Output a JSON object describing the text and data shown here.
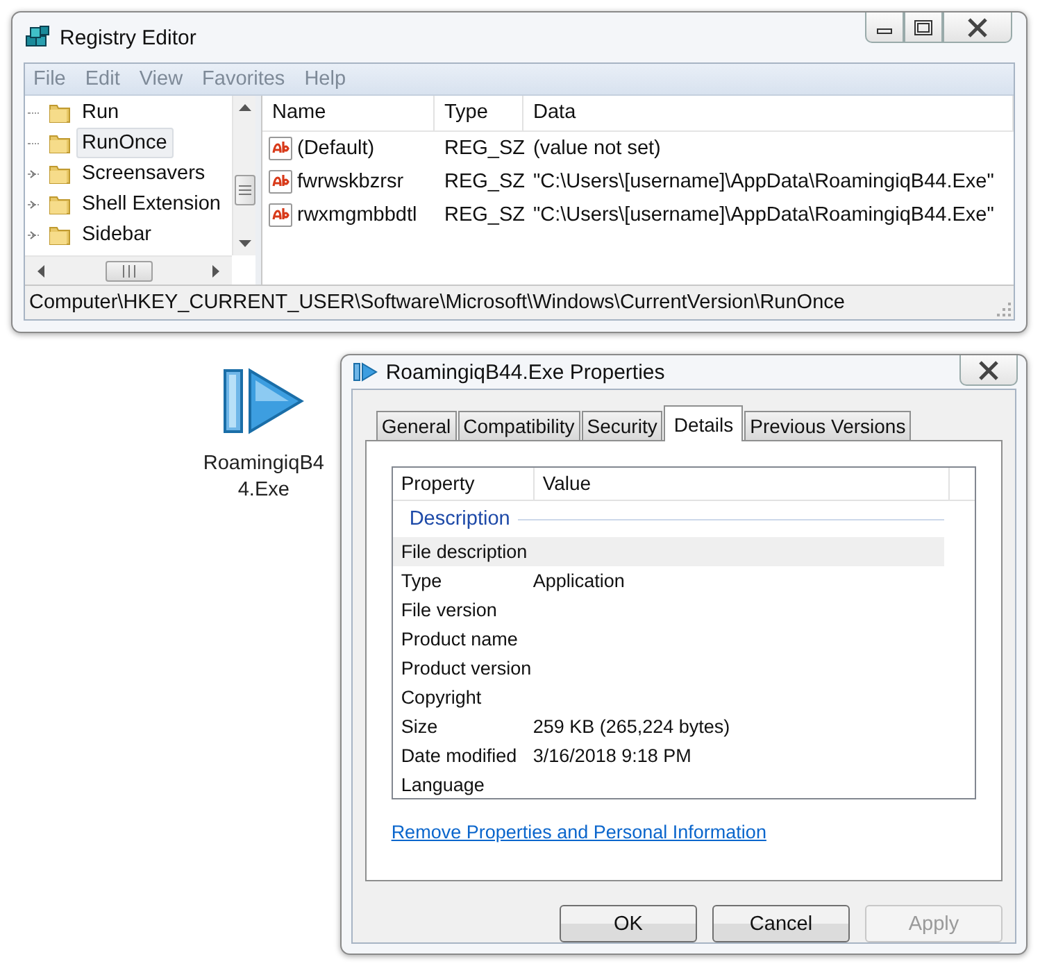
{
  "registry_editor": {
    "title": "Registry Editor",
    "menu": [
      "File",
      "Edit",
      "View",
      "Favorites",
      "Help"
    ],
    "tree": [
      {
        "label": "Run",
        "selected": false,
        "expandable": false
      },
      {
        "label": "RunOnce",
        "selected": true,
        "expandable": false
      },
      {
        "label": "Screensavers",
        "selected": false,
        "expandable": true
      },
      {
        "label": "Shell Extension",
        "selected": false,
        "expandable": true
      },
      {
        "label": "Sidebar",
        "selected": false,
        "expandable": true
      }
    ],
    "values": {
      "columns": [
        "Name",
        "Type",
        "Data"
      ],
      "rows": [
        {
          "name": "(Default)",
          "type": "REG_SZ",
          "data": "(value not set)"
        },
        {
          "name": "fwrwskbzrsr",
          "type": "REG_SZ",
          "data": "\"C:\\Users\\[username]\\AppData\\RoamingiqB44.Exe\""
        },
        {
          "name": "rwxmgmbbdtl",
          "type": "REG_SZ",
          "data": "\"C:\\Users\\[username]\\AppData\\RoamingiqB44.Exe\""
        }
      ]
    },
    "status_bar": "Computer\\HKEY_CURRENT_USER\\Software\\Microsoft\\Windows\\CurrentVersion\\RunOnce"
  },
  "desktop_icon": {
    "label": "RoamingiqB44.Exe"
  },
  "properties": {
    "title": "RoamingiqB44.Exe Properties",
    "tabs": [
      {
        "label": "General",
        "selected": false
      },
      {
        "label": "Compatibility",
        "selected": false
      },
      {
        "label": "Security",
        "selected": false
      },
      {
        "label": "Details",
        "selected": true
      },
      {
        "label": "Previous Versions",
        "selected": false
      }
    ],
    "columns": [
      "Property",
      "Value"
    ],
    "group": "Description",
    "rows": [
      {
        "property": "File description",
        "selected": true
      },
      {
        "property": "Type",
        "value": "Application",
        "selected": false
      },
      {
        "property": "File version",
        "selected": false
      },
      {
        "property": "Product name",
        "selected": false
      },
      {
        "property": "Product version",
        "selected": false
      },
      {
        "property": "Copyright",
        "selected": false
      },
      {
        "property": "Size",
        "value": "259 KB (265,224 bytes)",
        "selected": false
      },
      {
        "property": "Date modified",
        "value": "3/16/2018 9:18 PM",
        "selected": false
      },
      {
        "property": "Language",
        "selected": false
      }
    ],
    "link": "Remove Properties and Personal Information",
    "buttons": [
      {
        "label": "OK",
        "disabled": false
      },
      {
        "label": "Cancel",
        "disabled": false
      },
      {
        "label": "Apply",
        "disabled": true
      }
    ]
  }
}
